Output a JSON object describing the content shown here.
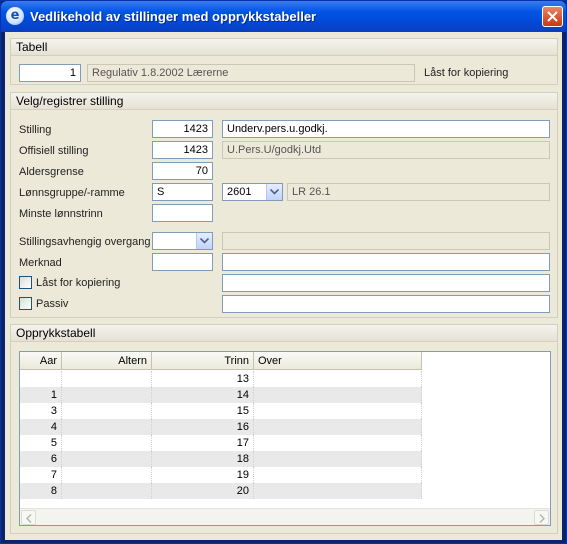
{
  "window": {
    "title": "Vedlikehold av stillinger med opprykkstabeller",
    "icon": "app-e-icon",
    "close_icon": "close-icon"
  },
  "tabell": {
    "header": "Tabell",
    "number": "1",
    "regulativ": "Regulativ 1.8.2002 Lærerne",
    "lock_label": "Låst for kopiering"
  },
  "stilling": {
    "header": "Velg/registrer stilling",
    "labels": {
      "stilling": "Stilling",
      "offisiell": "Offisiell stilling",
      "aldersgrense": "Aldersgrense",
      "lonnsgruppe": "Lønnsgruppe/-ramme",
      "minste": "Minste lønnstrinn",
      "avhengig": "Stillingsavhengig overgang",
      "merknad": "Merknad",
      "last": "Låst for kopiering",
      "passiv": "Passiv"
    },
    "values": {
      "stilling_code": "1423",
      "stilling_name": "Underv.pers.u.godkj.",
      "offisiell_code": "1423",
      "offisiell_name": "U.Pers.U/godkj.Utd",
      "aldersgrense": "70",
      "lonnsgruppe": "S",
      "ramme_select": "2601",
      "ramme_desc": "LR 26.1",
      "minste": "",
      "avhengig": "",
      "avhengig_desc": "",
      "merknad_short": "",
      "merknad_long": "",
      "last_extra": "",
      "passiv_extra": ""
    },
    "checkboxes": {
      "last": false,
      "passiv": false
    },
    "dropdown_icon": "chevron-down-icon"
  },
  "opprykk": {
    "header": "Opprykkstabell",
    "columns": [
      "Aar",
      "Altern",
      "Trinn",
      "Over"
    ],
    "rows": [
      {
        "aar": "",
        "altern": "",
        "trinn": "13",
        "over": ""
      },
      {
        "aar": "1",
        "altern": "",
        "trinn": "14",
        "over": ""
      },
      {
        "aar": "3",
        "altern": "",
        "trinn": "15",
        "over": ""
      },
      {
        "aar": "4",
        "altern": "",
        "trinn": "16",
        "over": ""
      },
      {
        "aar": "5",
        "altern": "",
        "trinn": "17",
        "over": ""
      },
      {
        "aar": "6",
        "altern": "",
        "trinn": "18",
        "over": ""
      },
      {
        "aar": "7",
        "altern": "",
        "trinn": "19",
        "over": ""
      },
      {
        "aar": "8",
        "altern": "",
        "trinn": "20",
        "over": ""
      }
    ],
    "scroll_icons": [
      "scroll-left-icon",
      "scroll-right-icon"
    ]
  }
}
